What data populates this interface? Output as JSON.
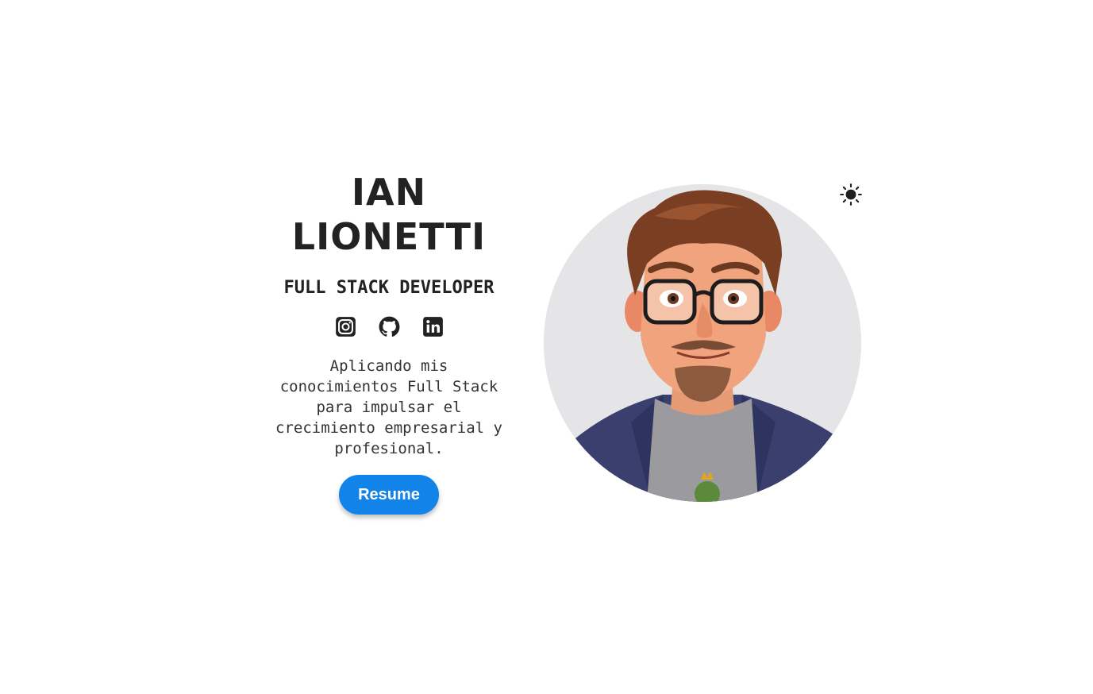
{
  "profile": {
    "first_name": "IAN",
    "last_name": "LIONETTI",
    "role": "FULL STACK DEVELOPER",
    "tagline": "Aplicando mis conocimientos Full Stack para impulsar el crecimiento empresarial y profesional.",
    "resume_label": "Resume"
  },
  "socials": [
    {
      "icon": "instagram-icon"
    },
    {
      "icon": "github-icon"
    },
    {
      "icon": "linkedin-icon"
    }
  ],
  "theme_toggle": {
    "icon": "sun-icon"
  },
  "colors": {
    "text": "#222222",
    "accent": "#1283e8",
    "avatar_bg": "#e5e4e6"
  }
}
